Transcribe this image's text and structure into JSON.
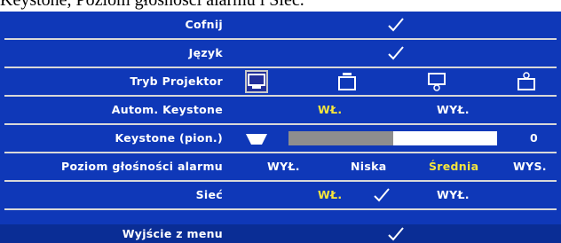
{
  "caption": "Keystone, Poziom głośności alarmu i Sieć.",
  "menu": {
    "cofnij": {
      "label": "Cofnij"
    },
    "jezyk": {
      "label": "Język"
    },
    "tryb": {
      "label": "Tryb Projektor",
      "modes": [
        "front-desktop",
        "front-ceiling",
        "rear-desktop",
        "rear-ceiling"
      ],
      "selected_index": 0
    },
    "autom_keystone": {
      "label": "Autom. Keystone",
      "on": "WŁ.",
      "off": "WYŁ.",
      "selected": "on"
    },
    "keystone": {
      "label": "Keystone (pion.)",
      "value": "0",
      "slider_level": 0.5
    },
    "alarm": {
      "label": "Poziom głośności alarmu",
      "options": [
        "WYŁ.",
        "Niska",
        "Średnia",
        "WYS."
      ],
      "selected_index": 2
    },
    "siec": {
      "label": "Sieć",
      "on": "WŁ.",
      "off": "WYŁ.",
      "selected": "on"
    },
    "exit": {
      "label": "Wyjście z menu"
    }
  },
  "colors": {
    "panel": "#0f38b8",
    "selected_text": "#f7e63c",
    "text": "#ffffff"
  }
}
